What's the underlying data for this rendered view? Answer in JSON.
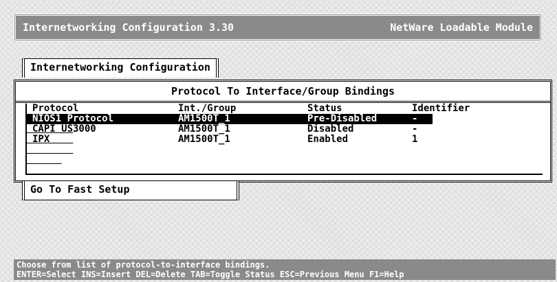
{
  "header": {
    "app_title": "Internetworking Configuration  3.30",
    "module_type": "NetWare Loadable Module"
  },
  "menu": {
    "title": "Internetworking Configuration"
  },
  "bindings": {
    "title": "Protocol To Interface/Group Bindings",
    "columns": [
      "Protocol",
      "Int./Group",
      "Status",
      "Identifier"
    ],
    "rows": [
      {
        "protocol": "NIOS1 Protocol",
        "group": "AM1500T_1",
        "status": "Pre-Disabled",
        "identifier": "-"
      },
      {
        "protocol": "CAPI US3000",
        "group": "AM1500T_1",
        "status": "Disabled",
        "identifier": "-"
      },
      {
        "protocol": "IPX",
        "group": "AM1500T_1",
        "status": "Enabled",
        "identifier": "1"
      }
    ],
    "selected_index": 0
  },
  "fast_setup": {
    "label": "Go To Fast Setup"
  },
  "status_bar": {
    "line1": "Choose from list of protocol-to-interface bindings.",
    "line2": "ENTER=Select INS=Insert DEL=Delete TAB=Toggle Status ESC=Previous Menu F1=Help"
  }
}
